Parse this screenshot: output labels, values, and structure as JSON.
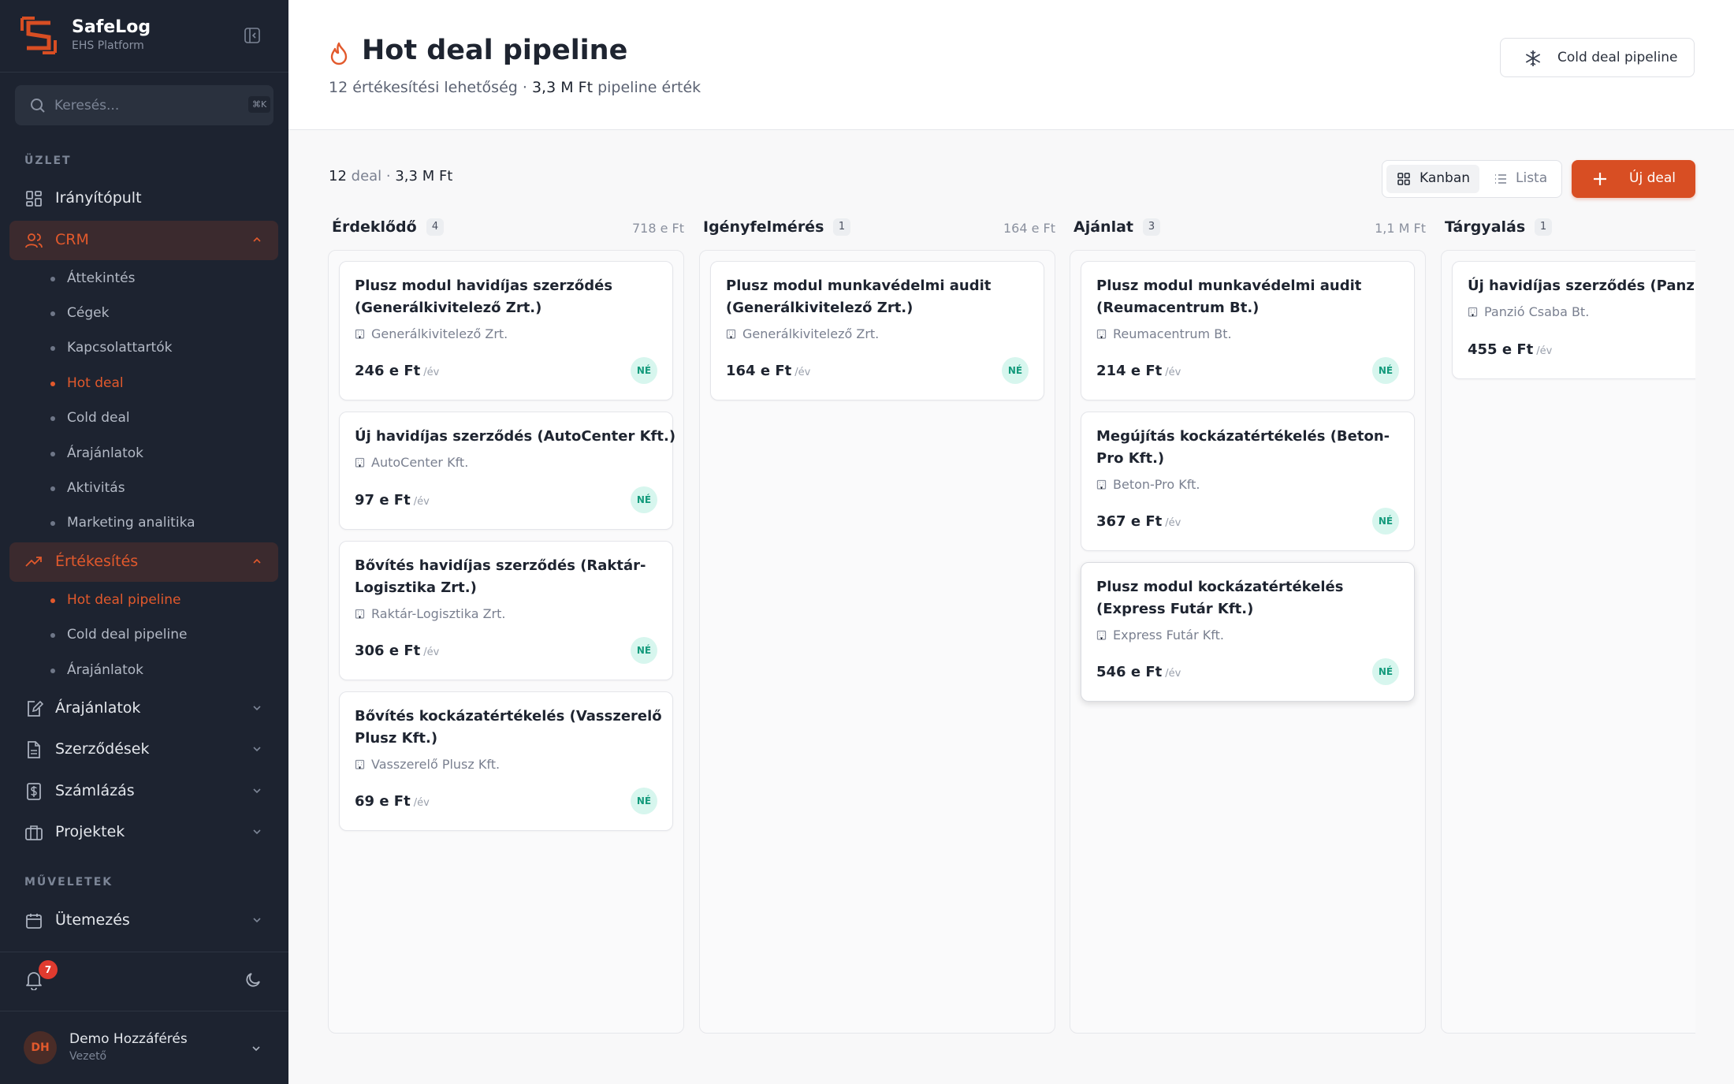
{
  "brand": {
    "name": "SafeLog",
    "subtitle": "EHS Platform"
  },
  "search": {
    "placeholder": "Keresés...",
    "shortcut": "⌘K"
  },
  "sidebar": {
    "section1": "ÜZLET",
    "section2": "MŰVELETEK",
    "items": {
      "dashboard": "Irányítópult",
      "crm": "CRM",
      "sales": "Értékesítés",
      "quotes": "Árajánlatok",
      "contracts": "Szerződések",
      "billing": "Számlázás",
      "projects": "Projektek",
      "schedule": "Ütemezés"
    },
    "crm_sub": [
      "Áttekintés",
      "Cégek",
      "Kapcsolattartók",
      "Hot deal",
      "Cold deal",
      "Árajánlatok",
      "Aktivitás",
      "Marketing analitika"
    ],
    "sales_sub": [
      "Hot deal pipeline",
      "Cold deal pipeline",
      "Árajánlatok"
    ],
    "notifications": "7",
    "user": {
      "initials": "DH",
      "name": "Demo Hozzáférés",
      "role": "Vezető"
    }
  },
  "header": {
    "title": "Hot deal pipeline",
    "subtitle_count": "12 értékesítési lehetőség",
    "subtitle_sep": " · ",
    "subtitle_value": "3,3 M Ft",
    "subtitle_suffix": " pipeline érték",
    "cold_button": "Cold deal pipeline"
  },
  "toolbar": {
    "count_num": "12",
    "count_word": "deal",
    "count_value": "3,3 M Ft",
    "kanban": "Kanban",
    "list": "Lista",
    "new_deal": "Új deal"
  },
  "columns": [
    {
      "name": "Érdeklődő",
      "count": "4",
      "sum": "718 e Ft",
      "cards": [
        {
          "title": "Plusz modul havidíjas szerződés (Generálkivitelező Zrt.)",
          "company": "Generálkivitelező Zrt.",
          "amount": "246 e Ft",
          "per": "/év",
          "tag": "NÉ"
        },
        {
          "title": "Új havidíjas szerződés (AutoCenter Kft.)",
          "company": "AutoCenter Kft.",
          "amount": "97 e Ft",
          "per": "/év",
          "tag": "NÉ"
        },
        {
          "title": "Bővítés havidíjas szerződés (Raktár-Logisztika Zrt.)",
          "company": "Raktár-Logisztika Zrt.",
          "amount": "306 e Ft",
          "per": "/év",
          "tag": "NÉ"
        },
        {
          "title": "Bővítés kockázatértékelés (Vasszerelő Plusz Kft.)",
          "company": "Vasszerelő Plusz Kft.",
          "amount": "69 e Ft",
          "per": "/év",
          "tag": "NÉ"
        }
      ]
    },
    {
      "name": "Igényfelmérés",
      "count": "1",
      "sum": "164 e Ft",
      "cards": [
        {
          "title": "Plusz modul munkavédelmi audit (Generálkivitelező Zrt.)",
          "company": "Generálkivitelező Zrt.",
          "amount": "164 e Ft",
          "per": "/év",
          "tag": "NÉ"
        }
      ]
    },
    {
      "name": "Ajánlat",
      "count": "3",
      "sum": "1,1 M Ft",
      "cards": [
        {
          "title": "Plusz modul munkavédelmi audit (Reumacentrum Bt.)",
          "company": "Reumacentrum Bt.",
          "amount": "214 e Ft",
          "per": "/év",
          "tag": "NÉ"
        },
        {
          "title": "Megújítás kockázatértékelés (Beton-Pro Kft.)",
          "company": "Beton-Pro Kft.",
          "amount": "367 e Ft",
          "per": "/év",
          "tag": "NÉ"
        },
        {
          "title": "Plusz modul kockázatértékelés (Express Futár Kft.)",
          "company": "Express Futár Kft.",
          "amount": "546 e Ft",
          "per": "/év",
          "tag": "NÉ"
        }
      ]
    },
    {
      "name": "Tárgyalás",
      "count": "1",
      "sum": "",
      "cards": [
        {
          "title": "Új havidíjas szerződés (Panzió Csaba Bt.)",
          "company": "Panzió Csaba Bt.",
          "amount": "455 e Ft",
          "per": "/év",
          "tag": ""
        }
      ]
    }
  ],
  "colors": {
    "accent": "#d84e23",
    "sidebar_bg": "#1d2330",
    "tag_bg": "#d7f6ee",
    "tag_fg": "#139a7c"
  }
}
